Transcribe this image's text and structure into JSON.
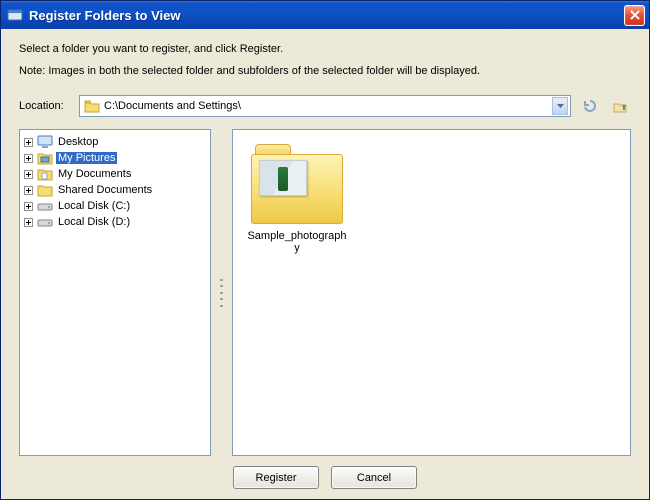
{
  "window": {
    "title": "Register Folders to View"
  },
  "instructions": "Select a folder you want to register, and click Register.",
  "note": "Note: Images in both the selected folder and subfolders of the selected folder will be displayed.",
  "location": {
    "label": "Location:",
    "path": "C:\\Documents and Settings\\"
  },
  "tree": {
    "items": [
      {
        "label": "Desktop",
        "icon": "desktop"
      },
      {
        "label": "My Pictures",
        "icon": "pictures",
        "selected": true
      },
      {
        "label": "My Documents",
        "icon": "documents"
      },
      {
        "label": "Shared Documents",
        "icon": "folder"
      },
      {
        "label": "Local Disk (C:)",
        "icon": "drive"
      },
      {
        "label": "Local Disk (D:)",
        "icon": "drive"
      }
    ]
  },
  "view": {
    "items": [
      {
        "label": "Sample_photography"
      }
    ]
  },
  "buttons": {
    "register": "Register",
    "cancel": "Cancel"
  }
}
